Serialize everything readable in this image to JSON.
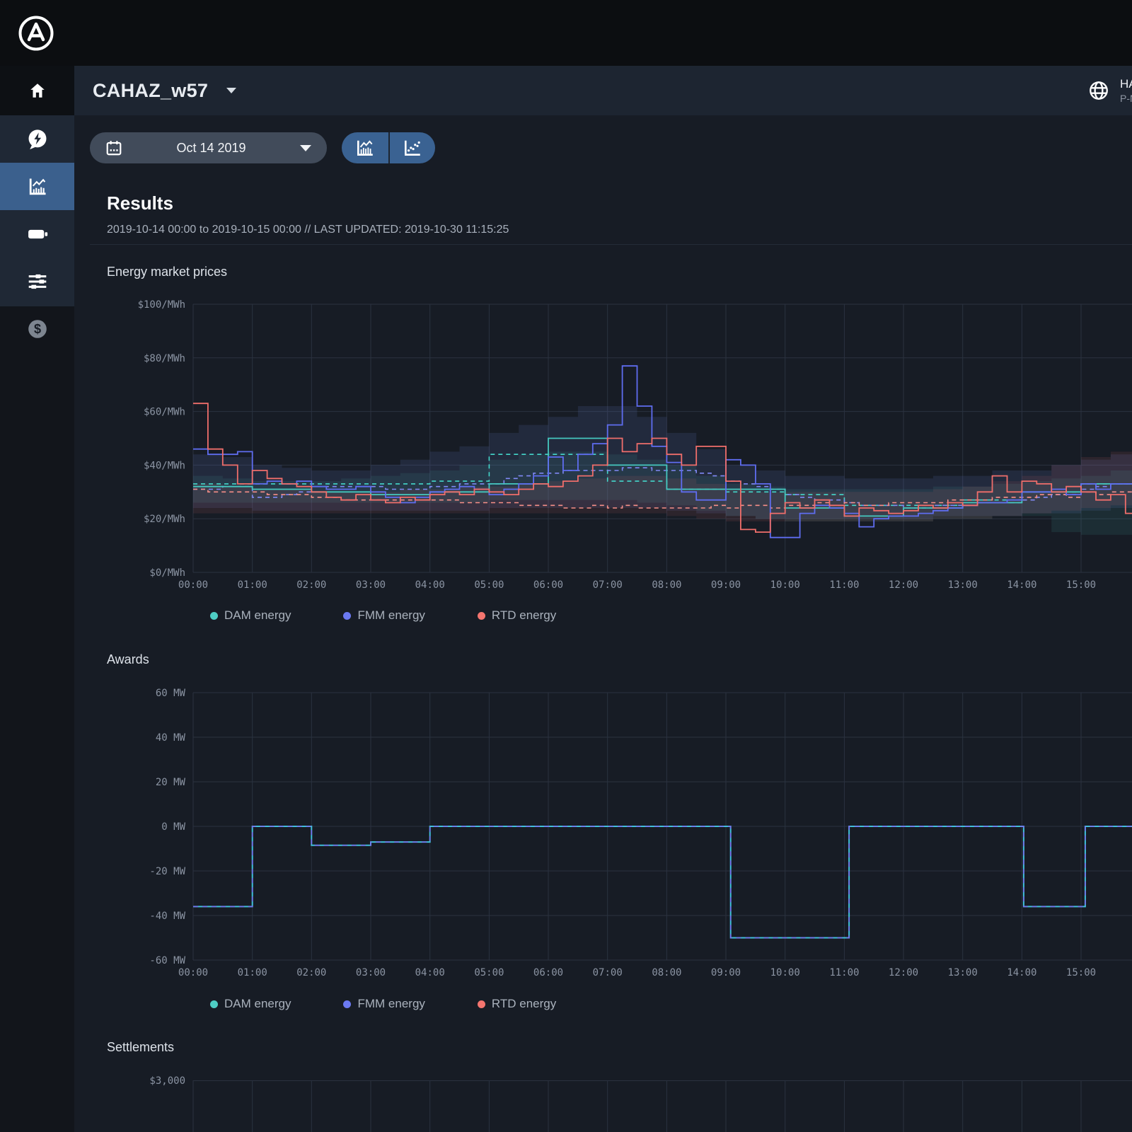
{
  "app": {
    "title": "CAHAZ_w57",
    "account_line1": "HAA",
    "account_line2": "P-NO"
  },
  "toolbar": {
    "date_label": "Oct 14 2019"
  },
  "results": {
    "title": "Results",
    "subtitle": "2019-10-14 00:00 to 2019-10-15 00:00 // LAST UPDATED: 2019-10-30 11:15:25"
  },
  "legend": [
    {
      "label": "DAM energy",
      "color": "#4ecdc4"
    },
    {
      "label": "FMM energy",
      "color": "#6b79f2"
    },
    {
      "label": "RTD energy",
      "color": "#f4756f"
    }
  ],
  "icons": {
    "dollar_glyph": "$"
  },
  "colors": {
    "dam": "#45c8bf",
    "fmm": "#5f6df0",
    "rtd": "#f06e6b",
    "dam_dash": "#44d8cb",
    "fmm_dash": "#8089f5",
    "rtd_dash": "#f78f88",
    "awards_dam": "#3fc0d8",
    "awards_fmm": "#7b6cf2",
    "band_fmm": "rgba(104,124,214,0.14)",
    "band_dam": "rgba(80,200,190,0.10)",
    "band_rtd": "rgba(235,110,110,0.10)"
  },
  "chart_data": [
    {
      "type": "line",
      "title": "Energy market prices",
      "ylabel": "$/MWh",
      "ylim": [
        0,
        100
      ],
      "yticks": [
        100,
        80,
        60,
        40,
        20,
        0
      ],
      "ytick_labels": [
        "$100/MWh",
        "$80/MWh",
        "$60/MWh",
        "$40/MWh",
        "$20/MWh",
        "$0/MWh"
      ],
      "xtick_labels": [
        "00:00",
        "01:00",
        "02:00",
        "03:00",
        "04:00",
        "05:00",
        "06:00",
        "07:00",
        "08:00",
        "09:00",
        "10:00",
        "11:00",
        "12:00",
        "13:00",
        "14:00",
        "15:00"
      ],
      "x_end_hours": 15.87,
      "grid": true,
      "legend_position": "bottom",
      "series": [
        {
          "name": "DAM energy",
          "role": "dam",
          "style": "solid",
          "step_hours": 1,
          "values": [
            32,
            31,
            30,
            29,
            30,
            33,
            50,
            40,
            31,
            31,
            24,
            21,
            24,
            26,
            30,
            33
          ]
        },
        {
          "name": "FMM energy",
          "role": "fmm",
          "style": "solid",
          "step_hours": 0.25,
          "values": [
            46,
            44,
            44,
            45,
            33,
            34,
            33,
            34,
            32,
            31,
            31,
            32,
            30,
            28,
            26,
            28,
            30,
            31,
            32,
            31,
            29,
            31,
            33,
            36,
            43,
            38,
            44,
            48,
            55,
            77,
            62,
            47,
            41,
            30,
            27,
            27,
            42,
            40,
            33,
            13,
            13,
            22,
            25,
            24,
            22,
            17,
            20,
            21,
            21,
            22,
            23,
            24,
            25,
            26,
            26,
            27,
            30,
            30,
            31,
            29,
            33,
            31,
            33,
            33
          ]
        },
        {
          "name": "RTD energy",
          "role": "rtd",
          "style": "solid",
          "step_hours": 0.25,
          "values": [
            63,
            46,
            40,
            33,
            38,
            35,
            33,
            32,
            30,
            28,
            27,
            29,
            27,
            26,
            28,
            27,
            29,
            30,
            29,
            31,
            30,
            29,
            31,
            33,
            32,
            34,
            36,
            40,
            50,
            45,
            48,
            50,
            44,
            40,
            47,
            47,
            34,
            16,
            15,
            22,
            26,
            24,
            27,
            25,
            21,
            24,
            23,
            22,
            23,
            25,
            24,
            26,
            25,
            30,
            36,
            30,
            34,
            33,
            30,
            32,
            30,
            27,
            29,
            22
          ]
        },
        {
          "name": "DAM energy (dashed)",
          "role": "dam_dash",
          "style": "dashed",
          "step_hours": 1,
          "values": [
            33,
            33,
            33,
            33,
            34,
            44,
            44,
            34,
            31,
            30,
            29,
            25,
            25,
            27,
            30,
            33
          ]
        },
        {
          "name": "FMM energy (dashed)",
          "role": "fmm_dash",
          "style": "dashed",
          "step_hours": 0.25,
          "values": [
            31,
            31,
            32,
            32,
            28,
            28,
            29,
            30,
            32,
            32,
            32,
            32,
            32,
            31,
            31,
            31,
            32,
            32,
            33,
            33,
            33,
            35,
            36,
            37,
            37,
            38,
            38,
            38,
            38,
            39,
            39,
            38,
            38,
            38,
            37,
            36,
            34,
            33,
            32,
            31,
            29,
            28,
            27,
            27,
            26,
            25,
            25,
            25,
            24,
            24,
            25,
            25,
            25,
            26,
            26,
            26,
            27,
            28,
            29,
            29,
            31,
            32,
            33,
            33
          ]
        },
        {
          "name": "RTD energy (dashed)",
          "role": "rtd_dash",
          "style": "dashed",
          "step_hours": 0.25,
          "values": [
            31,
            30,
            30,
            30,
            30,
            29,
            29,
            29,
            28,
            28,
            27,
            27,
            27,
            27,
            27,
            27,
            27,
            27,
            26,
            26,
            26,
            26,
            25,
            25,
            25,
            24,
            24,
            25,
            24,
            25,
            24,
            24,
            24,
            24,
            24,
            25,
            24,
            25,
            25,
            24,
            25,
            25,
            26,
            25,
            26,
            25,
            25,
            26,
            26,
            26,
            26,
            27,
            27,
            27,
            28,
            28,
            28,
            29,
            29,
            28,
            30,
            29,
            30,
            30
          ]
        }
      ],
      "bands": [
        {
          "role": "band_fmm",
          "step_hours": 0.5,
          "upper": [
            44,
            43,
            40,
            39,
            38,
            38,
            40,
            42,
            45,
            47,
            52,
            55,
            58,
            62,
            62,
            58,
            52,
            46,
            40,
            38,
            36,
            36,
            35,
            35,
            35,
            36,
            36,
            38,
            38,
            40,
            42,
            44
          ],
          "lower": [
            24,
            24,
            23,
            23,
            23,
            23,
            23,
            23,
            23,
            23,
            24,
            24,
            24,
            24,
            24,
            24,
            23,
            22,
            21,
            20,
            20,
            20,
            20,
            20,
            20,
            21,
            21,
            21,
            22,
            22,
            23,
            24
          ]
        },
        {
          "role": "band_dam",
          "step_hours": 0.5,
          "upper": [
            36,
            35,
            34,
            34,
            34,
            35,
            36,
            37,
            38,
            40,
            42,
            44,
            45,
            45,
            44,
            42,
            40,
            36,
            33,
            32,
            31,
            31,
            31,
            31,
            31,
            32,
            32,
            33,
            34,
            35,
            36,
            38
          ],
          "lower": [
            26,
            26,
            26,
            26,
            26,
            26,
            26,
            26,
            26,
            26,
            27,
            27,
            27,
            27,
            27,
            26,
            25,
            23,
            21,
            20,
            19,
            19,
            19,
            19,
            19,
            20,
            20,
            21,
            21,
            15,
            14,
            14
          ]
        },
        {
          "role": "band_rtd",
          "step_hours": 0.5,
          "upper": [
            33,
            32,
            31,
            31,
            30,
            30,
            30,
            31,
            31,
            32,
            32,
            33,
            34,
            35,
            36,
            36,
            35,
            33,
            31,
            30,
            30,
            30,
            30,
            30,
            30,
            31,
            32,
            34,
            36,
            40,
            43,
            45
          ],
          "lower": [
            22,
            22,
            22,
            22,
            22,
            22,
            22,
            22,
            22,
            22,
            22,
            22,
            22,
            22,
            22,
            22,
            21,
            20,
            19,
            19,
            19,
            19,
            19,
            19,
            19,
            20,
            20,
            21,
            22,
            23,
            24,
            25
          ]
        }
      ]
    },
    {
      "type": "line",
      "title": "Awards",
      "ylabel": "MW",
      "ylim": [
        -60,
        60
      ],
      "yticks": [
        60,
        40,
        20,
        0,
        -20,
        -40,
        -60
      ],
      "ytick_labels": [
        "60 MW",
        "40 MW",
        "20 MW",
        "0 MW",
        "-20 MW",
        "-40 MW",
        "-60 MW"
      ],
      "xtick_labels": [
        "00:00",
        "01:00",
        "02:00",
        "03:00",
        "04:00",
        "05:00",
        "06:00",
        "07:00",
        "08:00",
        "09:00",
        "10:00",
        "11:00",
        "12:00",
        "13:00",
        "14:00",
        "15:00"
      ],
      "x_end_hours": 15.87,
      "grid": true,
      "legend_position": "bottom",
      "series": [
        {
          "name": "DAM energy",
          "role": "awards_dam",
          "style": "solid",
          "segments": [
            [
              0,
              1,
              -36
            ],
            [
              1,
              2,
              0
            ],
            [
              2,
              3,
              -8.5
            ],
            [
              3,
              4,
              -7
            ],
            [
              4,
              9.08,
              0
            ],
            [
              9.08,
              11.08,
              -50
            ],
            [
              11.08,
              14.03,
              0
            ],
            [
              14.03,
              15.07,
              -36
            ],
            [
              15.07,
              15.87,
              0
            ]
          ]
        },
        {
          "name": "FMM energy",
          "role": "awards_fmm",
          "style": "dashed",
          "segments": [
            [
              0,
              1,
              -36
            ],
            [
              1,
              2,
              0
            ],
            [
              2,
              3,
              -8.5
            ],
            [
              3,
              4,
              -7
            ],
            [
              4,
              9.08,
              0
            ],
            [
              9.08,
              11.08,
              -50
            ],
            [
              11.08,
              14.03,
              0
            ],
            [
              14.03,
              15.07,
              -36
            ],
            [
              15.07,
              15.87,
              0
            ]
          ]
        }
      ]
    },
    {
      "type": "line",
      "title": "Settlements",
      "ylabel": "$",
      "ytick_labels": [
        "$3,000"
      ],
      "partial_view": true
    }
  ]
}
